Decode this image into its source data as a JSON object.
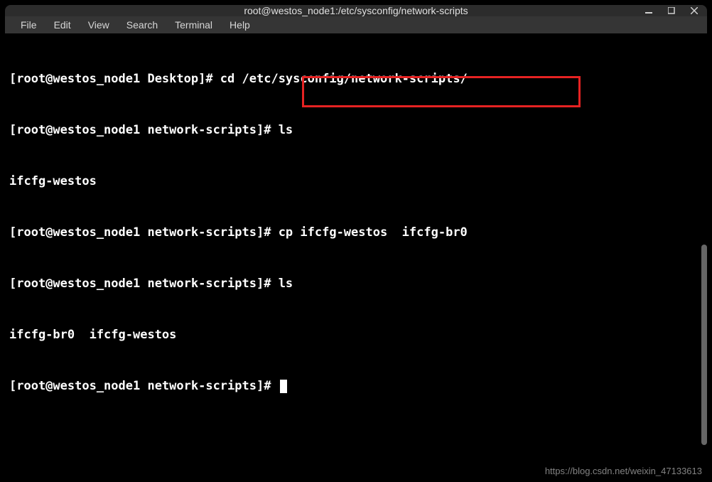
{
  "titlebar": {
    "title": "root@westos_node1:/etc/sysconfig/network-scripts"
  },
  "menubar": {
    "items": [
      "File",
      "Edit",
      "View",
      "Search",
      "Terminal",
      "Help"
    ]
  },
  "terminal": {
    "lines": [
      "[root@westos_node1 Desktop]# cd /etc/sysconfig/network-scripts/",
      "[root@westos_node1 network-scripts]# ls",
      "ifcfg-westos",
      "[root@westos_node1 network-scripts]# cp ifcfg-westos  ifcfg-br0",
      "[root@westos_node1 network-scripts]# ls",
      "ifcfg-br0  ifcfg-westos",
      "[root@westos_node1 network-scripts]# "
    ]
  },
  "watermark": "https://blog.csdn.net/weixin_47133613"
}
